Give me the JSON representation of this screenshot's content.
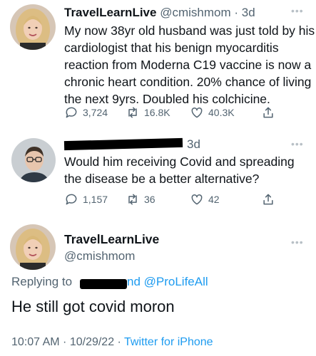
{
  "tweet1": {
    "display_name": "TravelLearnLive",
    "handle": "@cmishmom",
    "time": "· 3d",
    "text": "My now 38yr old husband was just told by his cardiologist that his benign myocarditis reaction from Moderna C19 vaccine is now a chronic heart condition. 20% chance of living the next 9yrs. Doubled his colchicine.",
    "replies": "3,724",
    "retweets": "16.8K",
    "likes": "40.3K"
  },
  "tweet2": {
    "time": "3d",
    "text": "Would him receiving Covid and spreading the disease be a better alternative?",
    "replies": "1,157",
    "retweets": "36",
    "likes": "42"
  },
  "tweet3": {
    "display_name": "TravelLearnLive",
    "handle": "@cmishmom",
    "replying_prefix": "Replying to",
    "replying_suffix": "nd @ProLifeAll",
    "text": "He still got covid moron",
    "timestamp": "10:07 AM · 10/29/22 ·",
    "source": "Twitter for iPhone"
  },
  "icons": [
    "reply-icon",
    "retweet-icon",
    "like-icon",
    "share-icon",
    "more-icon"
  ],
  "colors": {
    "link": "#1d9bf0",
    "secondary": "#536471",
    "text": "#0f1419"
  }
}
